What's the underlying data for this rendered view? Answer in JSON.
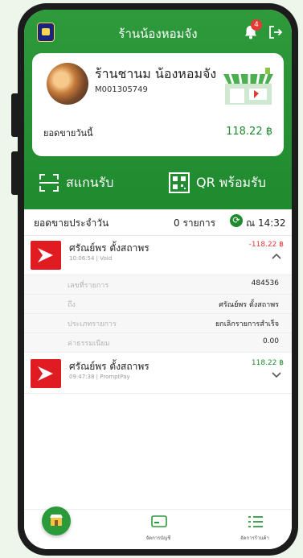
{
  "header": {
    "title": "ร้านน้องหอมจัง",
    "notification_count": "4"
  },
  "store": {
    "name": "ร้านชานม น้องหอมจัง",
    "merchant_id": "M001305749",
    "today_sales_label": "ยอดขายวันนี้",
    "today_sales_amount": "118.22 ฿"
  },
  "actions": {
    "scan_label": "สแกนรับ",
    "qr_label": "QR พร้อมรับ"
  },
  "daily": {
    "title": "ยอดขายประจำวัน",
    "count": "0 รายการ",
    "time": "ณ 14:32"
  },
  "transactions": [
    {
      "name": "ศรัณย์พร ตั้งสถาพร",
      "meta": "10:06:54 | Void",
      "amount": "-118.22 ฿",
      "details": [
        {
          "label": "เลขที่รายการ",
          "value": "484536"
        },
        {
          "label": "ถึง",
          "value": "ศรัณย์พร ตั้งสถาพร"
        },
        {
          "label": "ประเภทรายการ",
          "value": "ยกเลิกรายการสำเร็จ"
        },
        {
          "label": "ค่าธรรมเนียม",
          "value": "0.00"
        }
      ]
    },
    {
      "name": "ศรัณย์พร ตั้งสถาพร",
      "meta": "09:47:38 | PromptPay",
      "amount": "118.22 ฿"
    }
  ],
  "bottom_nav": {
    "account_label": "จัดการบัญชี",
    "store_label": "จัดการร้านค้า"
  },
  "colors": {
    "brand_green": "#1f8a2e",
    "negative_red": "#e53935",
    "bank_red": "#e11b22"
  }
}
